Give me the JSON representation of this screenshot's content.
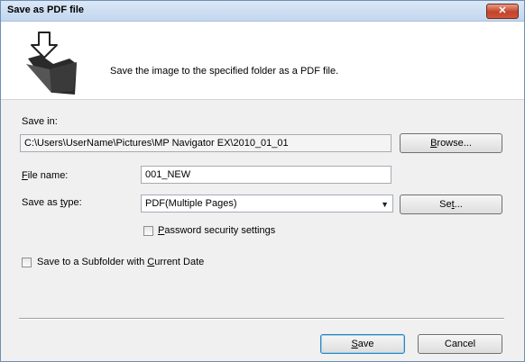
{
  "window": {
    "title": "Save as PDF file",
    "close_glyph": "✕"
  },
  "header": {
    "icon": "pdf-save-folder-icon",
    "description": "Save the image to the specified folder as a PDF file."
  },
  "save_in": {
    "label": "Save in:",
    "path": "C:\\Users\\UserName\\Pictures\\MP Navigator EX\\2010_01_01",
    "browse_label": "Browse...",
    "browse_mnemonic": "B",
    "browse_rest": "rowse..."
  },
  "file_name": {
    "label": "File name:",
    "label_mnemonic": "F",
    "label_rest": "ile name:",
    "value": "001_NEW"
  },
  "save_as_type": {
    "label": "Save as type:",
    "label_prefix": "Save as ",
    "label_mnemonic": "t",
    "label_rest": "ype:",
    "selected": "PDF(Multiple Pages)",
    "set_label": "Set...",
    "set_prefix": "Se",
    "set_mnemonic": "t",
    "set_rest": "..."
  },
  "password": {
    "label": "Password security settings",
    "label_mnemonic": "P",
    "label_rest": "assword security settings",
    "checked": false
  },
  "subfolder": {
    "label": "Save to a Subfolder with Current Date",
    "label_prefix": "Save to a Subfolder with ",
    "label_mnemonic": "C",
    "label_rest": "urrent Date",
    "checked": false
  },
  "footer": {
    "save_label": "Save",
    "save_mnemonic": "S",
    "save_rest": "ave",
    "cancel_label": "Cancel"
  }
}
